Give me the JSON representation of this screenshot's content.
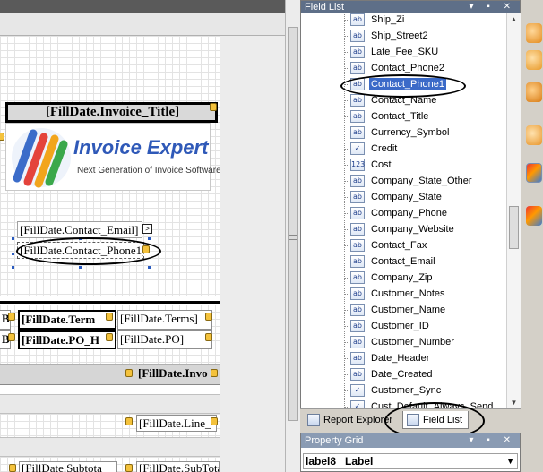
{
  "designer": {
    "invoice_title_field": "[FillDate.Invoice_Title]",
    "logo": {
      "name": "Invoice Expert",
      "tagline": "Next Generation of Invoice Software"
    },
    "contact_email_field": "[FillDate.Contact_Email]",
    "contact_phone_field": "[FillDate.Contact_Phone1]",
    "row1": {
      "prefix": "B",
      "terms_bold": "[FillDate.Term",
      "terms": "[FillDate.Terms]"
    },
    "row2": {
      "prefix": "B",
      "po_bold": "[FillDate.PO_H",
      "po": "[FillDate.PO]"
    },
    "band_invoice_field": "[FillDate.Invo",
    "line_field": "[FillDate.Line_",
    "bottom_left": "[FillDate.Subtota",
    "bottom_right": "[FillDate.SubTota"
  },
  "field_list": {
    "title": "Field List",
    "items": [
      {
        "label": "Ship_Zi",
        "icon": "ab"
      },
      {
        "label": "Ship_Street2",
        "icon": "ab"
      },
      {
        "label": "Late_Fee_SKU",
        "icon": "ab"
      },
      {
        "label": "Contact_Phone2",
        "icon": "ab"
      },
      {
        "label": "Contact_Phone1",
        "icon": "ab",
        "selected": true
      },
      {
        "label": "Contact_Name",
        "icon": "ab"
      },
      {
        "label": "Contact_Title",
        "icon": "ab"
      },
      {
        "label": "Currency_Symbol",
        "icon": "ab"
      },
      {
        "label": "Credit",
        "icon": "check"
      },
      {
        "label": "Cost",
        "icon": "123"
      },
      {
        "label": "Company_State_Other",
        "icon": "ab"
      },
      {
        "label": "Company_State",
        "icon": "ab"
      },
      {
        "label": "Company_Phone",
        "icon": "ab"
      },
      {
        "label": "Company_Website",
        "icon": "ab"
      },
      {
        "label": "Contact_Fax",
        "icon": "ab"
      },
      {
        "label": "Contact_Email",
        "icon": "ab"
      },
      {
        "label": "Company_Zip",
        "icon": "ab"
      },
      {
        "label": "Customer_Notes",
        "icon": "ab"
      },
      {
        "label": "Customer_Name",
        "icon": "ab"
      },
      {
        "label": "Customer_ID",
        "icon": "ab"
      },
      {
        "label": "Customer_Number",
        "icon": "ab"
      },
      {
        "label": "Date_Header",
        "icon": "ab"
      },
      {
        "label": "Date_Created",
        "icon": "ab"
      },
      {
        "label": "Customer_Sync",
        "icon": "check"
      },
      {
        "label": "Cust_Default_Always_Send",
        "icon": "check"
      }
    ]
  },
  "tabs": {
    "report_explorer": "Report Explorer",
    "field_list": "Field List"
  },
  "property_grid": {
    "title": "Property Grid",
    "selected_object": "label8",
    "selected_type": "Label"
  }
}
